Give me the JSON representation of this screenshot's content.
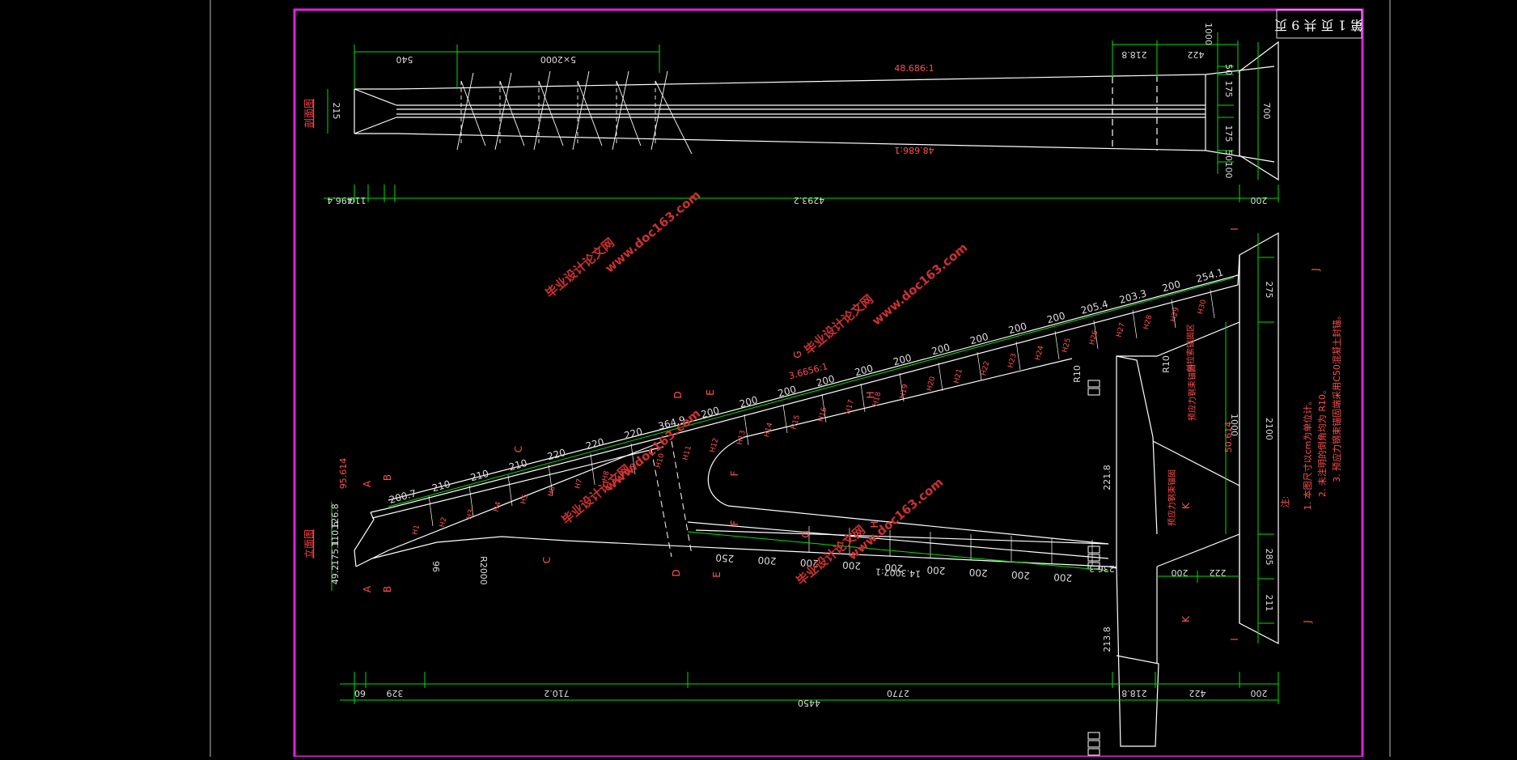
{
  "title_block": {
    "text": "第 1 页 共 9 页"
  },
  "top_view": {
    "label": "剖面图",
    "dims": {
      "d540": "540",
      "d5x2000": "5×2000",
      "d218": "218.8",
      "d422": "422",
      "d1000": "1000",
      "d50a": "50",
      "d175a": "175",
      "d175b": "175",
      "d50b": "50",
      "d100": "100",
      "d700": "700",
      "d215": "215",
      "slope_top": "48.686:1",
      "slope_bot": "48.686:1",
      "total": "4293.2",
      "left_a": "110",
      "left_b": "496.4",
      "right_200": "200"
    }
  },
  "side_view": {
    "label": "立面图",
    "slope_upper": "3.6656:1",
    "slope_lower": "14.3007:1",
    "upper_segments": [
      "200.7",
      "210",
      "210",
      "210",
      "220",
      "220",
      "220",
      "364.9",
      "200",
      "200",
      "200",
      "200",
      "200",
      "200",
      "200",
      "200",
      "200",
      "200",
      "205.4",
      "203.3",
      "200",
      "254.1"
    ],
    "upper_ticks": [
      "H1",
      "H2",
      "H3",
      "H4",
      "H5",
      "H6",
      "H7",
      "H8",
      "H9",
      "H10",
      "H11",
      "H12",
      "H13",
      "H14",
      "H15",
      "H16",
      "H17",
      "H18",
      "H19",
      "H20",
      "H21",
      "H22",
      "H23",
      "H24",
      "H25",
      "H26",
      "H27",
      "H28",
      "H29",
      "H30"
    ],
    "lower_segments": [
      "250",
      "200",
      "200",
      "200",
      "200",
      "200",
      "200",
      "200",
      "200"
    ],
    "left_stack": [
      "49.2",
      "175.1",
      "110.6",
      "126.8"
    ],
    "d96": "96",
    "r2000": "R2000",
    "d95614": "95.614",
    "d50614": "50.614",
    "right_dims": [
      "275",
      "1000",
      "2100",
      "285",
      "211"
    ],
    "right_r10a": "R10",
    "right_r10b": "R10",
    "d200": "200",
    "d222": "222",
    "d2218": "221.8",
    "d2138": "213.8",
    "d236": "236.3",
    "bottom_dims": [
      "60",
      "329",
      "710.2",
      "2770",
      "218.8",
      "422",
      "200"
    ],
    "bottom_total": "4450",
    "section_marks": [
      "A",
      "A",
      "B",
      "B",
      "C",
      "C",
      "D",
      "D",
      "E",
      "E",
      "F",
      "F",
      "G",
      "G",
      "H",
      "H",
      "I",
      "I",
      "J",
      "J",
      "K",
      "K"
    ],
    "labels_red": [
      "预应力钢束锚固",
      "预应力钢束锚固",
      "斜拉索锚固区"
    ],
    "notes_title": "注:",
    "notes": [
      "1. 本图尺寸以cm为单位计。",
      "2. 未注明的倒角均为 R10。",
      "3. 预应力钢束锚固端采用C50混凝土封锚。"
    ]
  },
  "watermarks": [
    "毕业设计论文网",
    "www.doc163.com"
  ]
}
